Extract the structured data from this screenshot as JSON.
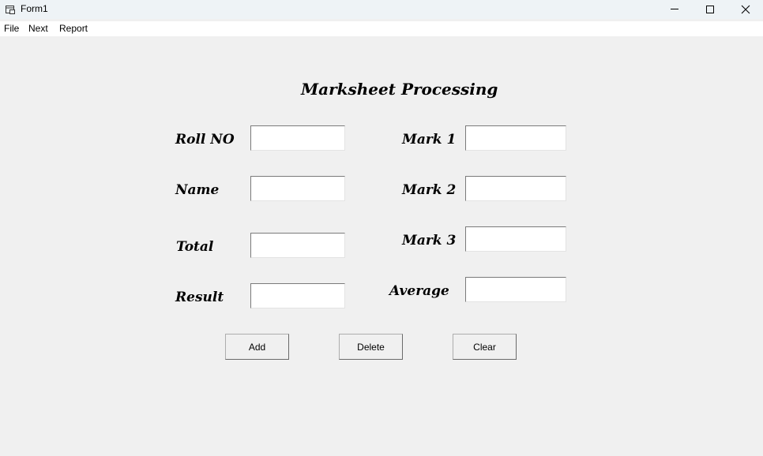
{
  "window": {
    "title": "Form1",
    "icons": {
      "app": "form-icon",
      "minimize": "minimize-icon",
      "maximize": "maximize-icon",
      "close": "close-icon"
    }
  },
  "menu": {
    "items": [
      "File",
      "Next",
      "Report"
    ]
  },
  "form": {
    "heading": "Marksheet Processing",
    "labels": {
      "roll_no": "Roll NO",
      "name": "Name",
      "total": "Total",
      "result": "Result",
      "mark1": "Mark 1",
      "mark2": "Mark 2",
      "mark3": "Mark 3",
      "average": "Average"
    },
    "values": {
      "roll_no": "",
      "name": "",
      "total": "",
      "result": "",
      "mark1": "",
      "mark2": "",
      "mark3": "",
      "average": ""
    },
    "buttons": {
      "add": "Add",
      "delete": "Delete",
      "clear": "Clear"
    }
  }
}
